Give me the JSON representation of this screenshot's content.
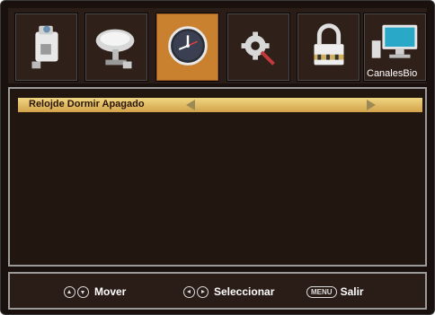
{
  "tabs": [
    {
      "icon": "camcorder-icon",
      "label": ""
    },
    {
      "icon": "satellite-dish-icon",
      "label": ""
    },
    {
      "icon": "clock-icon",
      "label": "",
      "active": true
    },
    {
      "icon": "gear-tool-icon",
      "label": ""
    },
    {
      "icon": "padlock-icon",
      "label": ""
    },
    {
      "icon": "computer-icon",
      "label": "CanalesBio"
    }
  ],
  "menu": {
    "item_label": "Relojde Dormir Apagado"
  },
  "footer": {
    "move_label": "Mover",
    "select_label": "Seleccionar",
    "menu_key": "MENU",
    "exit_label": "Salir"
  },
  "colors": {
    "active_tab": "#c98130",
    "highlight_row": "#e6c36a",
    "background": "#1a110e"
  }
}
